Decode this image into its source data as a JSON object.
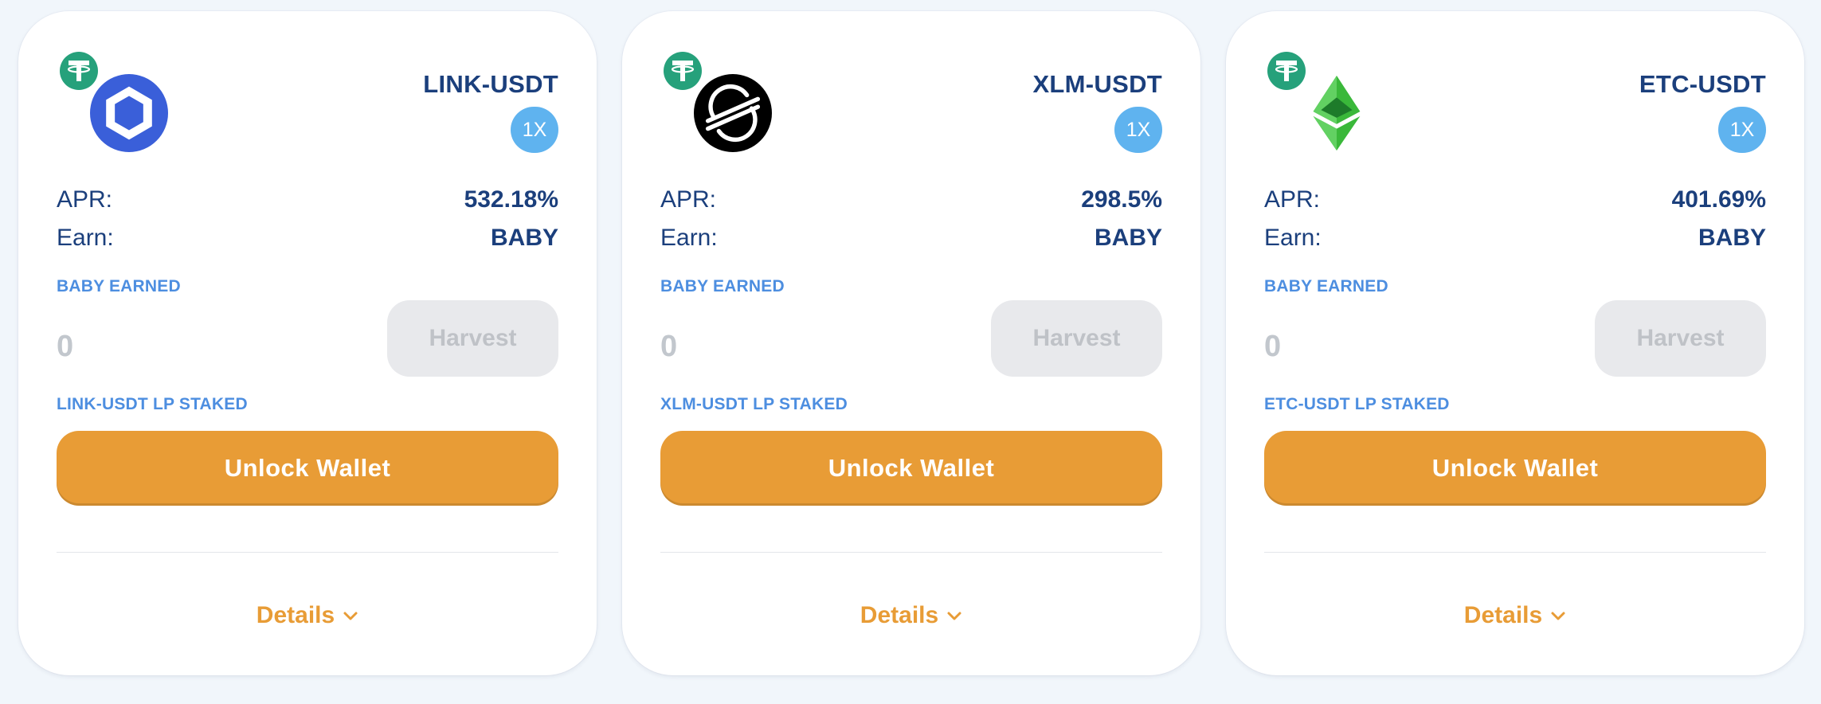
{
  "colors": {
    "page_background": "#f1f6fb",
    "card_background": "#ffffff",
    "primary_text": "#1b3f7c",
    "section_title": "#4d8ee0",
    "accent_orange": "#e89c36",
    "multiplier_badge": "#5fb3ef",
    "harvest_disabled_bg": "#e8e9ec",
    "harvest_disabled_text": "#bfc2c7"
  },
  "farms": [
    {
      "pair": "LINK-USDT",
      "token_icon": "chainlink-icon",
      "quote_icon": "tether-icon",
      "multiplier": "1X",
      "apr_label": "APR:",
      "apr_value": "532.18%",
      "earn_label": "Earn:",
      "earn_value": "BABY",
      "earned_title": "BABY EARNED",
      "earned_amount": "0",
      "harvest_label": "Harvest",
      "staked_title": "LINK-USDT LP STAKED",
      "unlock_label": "Unlock Wallet",
      "details_label": "Details"
    },
    {
      "pair": "XLM-USDT",
      "token_icon": "stellar-icon",
      "quote_icon": "tether-icon",
      "multiplier": "1X",
      "apr_label": "APR:",
      "apr_value": "298.5%",
      "earn_label": "Earn:",
      "earn_value": "BABY",
      "earned_title": "BABY EARNED",
      "earned_amount": "0",
      "harvest_label": "Harvest",
      "staked_title": "XLM-USDT LP STAKED",
      "unlock_label": "Unlock Wallet",
      "details_label": "Details"
    },
    {
      "pair": "ETC-USDT",
      "token_icon": "ethereum-classic-icon",
      "quote_icon": "tether-icon",
      "multiplier": "1X",
      "apr_label": "APR:",
      "apr_value": "401.69%",
      "earn_label": "Earn:",
      "earn_value": "BABY",
      "earned_title": "BABY EARNED",
      "earned_amount": "0",
      "harvest_label": "Harvest",
      "staked_title": "ETC-USDT LP STAKED",
      "unlock_label": "Unlock Wallet",
      "details_label": "Details"
    }
  ]
}
